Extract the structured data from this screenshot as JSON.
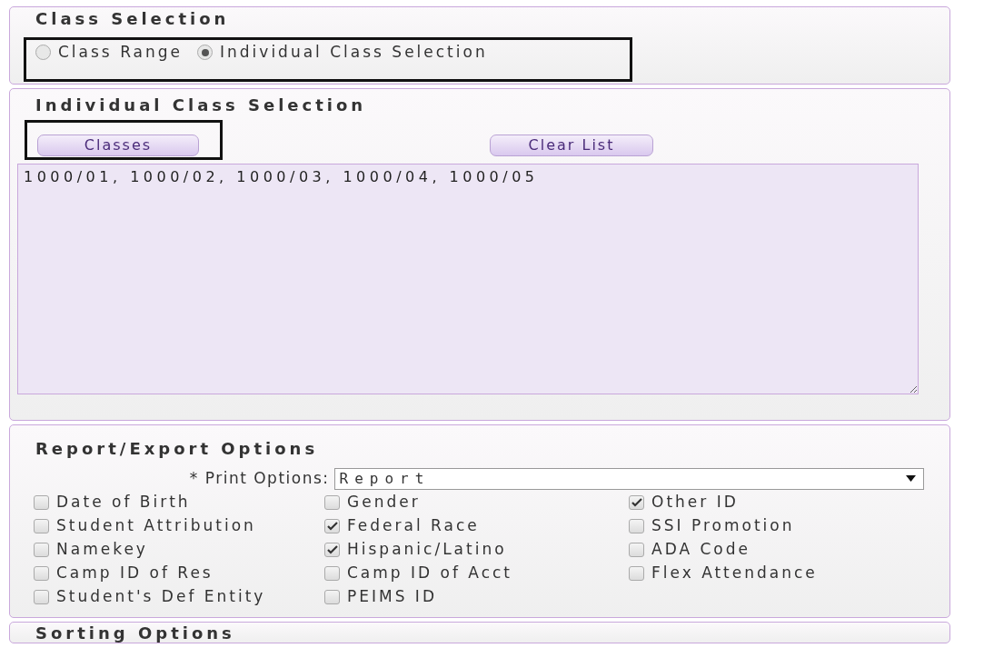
{
  "class_selection": {
    "title": "Class Selection",
    "highlighted": true,
    "options": [
      {
        "label": "Class Range",
        "selected": false
      },
      {
        "label": "Individual Class Selection",
        "selected": true
      }
    ]
  },
  "individual_class_selection": {
    "title": "Individual Class Selection",
    "classes_button": {
      "label": "Classes",
      "highlighted": true
    },
    "clear_button": {
      "label": "Clear List"
    },
    "class_list": {
      "value": "1000/01, 1000/02, 1000/03, 1000/04, 1000/05"
    }
  },
  "report_export_options": {
    "title": "Report/Export Options",
    "print_options": {
      "label": "* Print Options:",
      "value": "Report"
    },
    "columns": [
      [
        {
          "label": "Date of Birth",
          "checked": false
        },
        {
          "label": "Student Attribution",
          "checked": false
        },
        {
          "label": "Namekey",
          "checked": false
        },
        {
          "label": "Camp ID of Res",
          "checked": false
        },
        {
          "label": "Student's Def Entity",
          "checked": false
        }
      ],
      [
        {
          "label": "Gender",
          "checked": false
        },
        {
          "label": "Federal Race",
          "checked": true
        },
        {
          "label": "Hispanic/Latino",
          "checked": true
        },
        {
          "label": "Camp ID of Acct",
          "checked": false
        },
        {
          "label": "PEIMS ID",
          "checked": false
        }
      ],
      [
        {
          "label": "Other ID",
          "checked": true
        },
        {
          "label": "SSI Promotion",
          "checked": false
        },
        {
          "label": "ADA Code",
          "checked": false
        },
        {
          "label": "Flex Attendance",
          "checked": false
        }
      ]
    ]
  },
  "sorting_options": {
    "title": "Sorting Options"
  }
}
